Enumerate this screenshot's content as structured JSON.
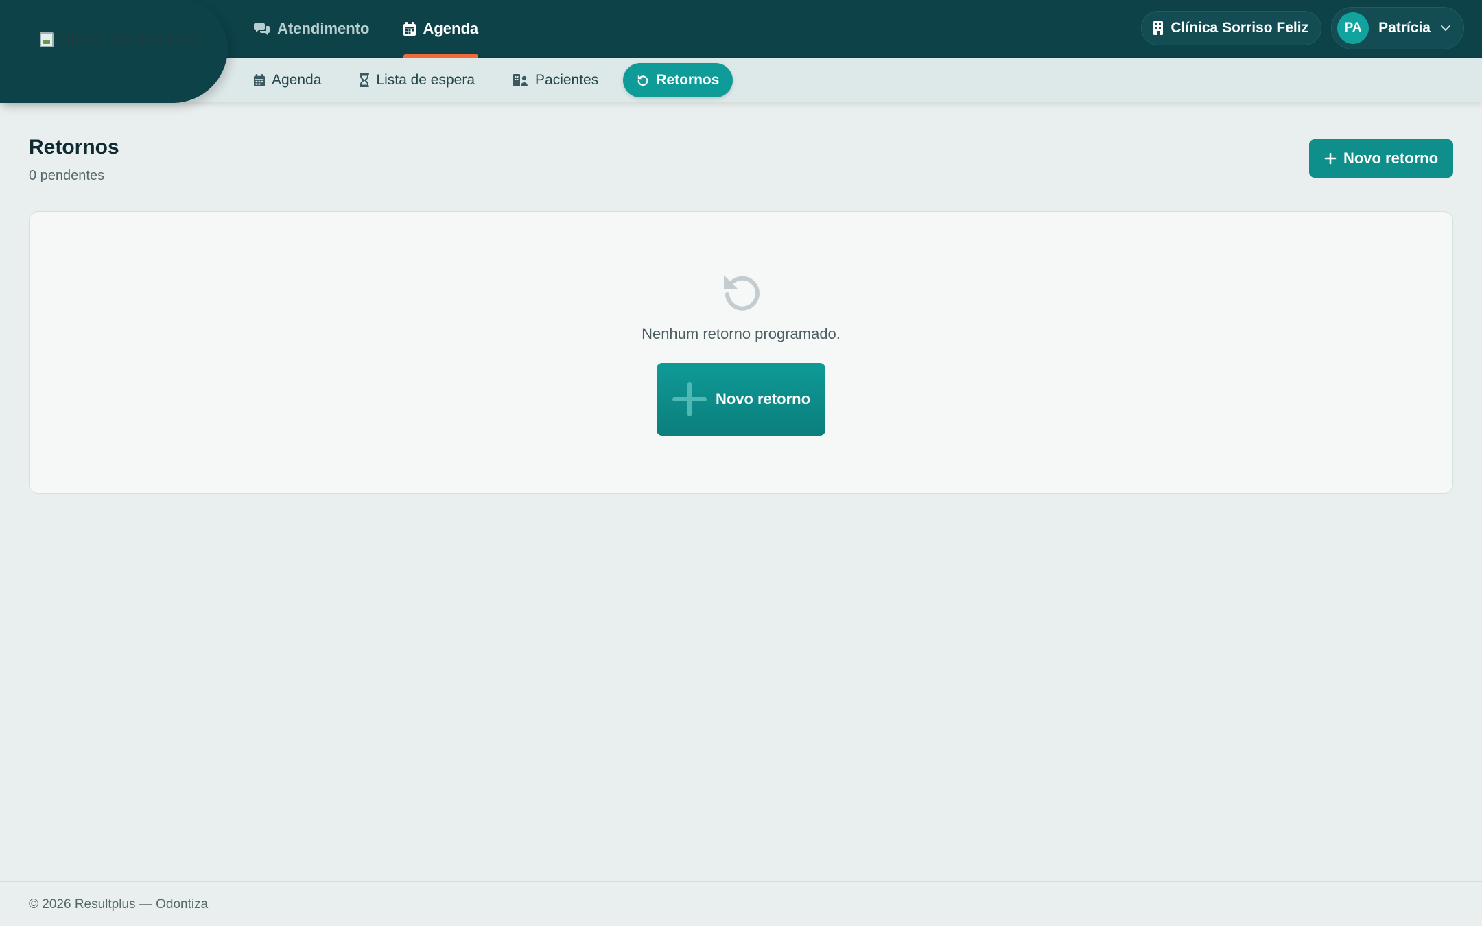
{
  "brand": {
    "logo_alt": "Clínica Sorriso Feliz"
  },
  "main_nav": {
    "items": [
      {
        "label": "Atendimento",
        "icon": "chat-icon",
        "active": false
      },
      {
        "label": "Agenda",
        "icon": "calendar-icon",
        "active": true
      }
    ]
  },
  "top_right": {
    "clinic_name": "Clínica Sorriso Feliz",
    "user_initials": "PA",
    "user_name": "Patrícia"
  },
  "sub_nav": {
    "items": [
      {
        "label": "Agenda",
        "icon": "calendar-icon",
        "active": false
      },
      {
        "label": "Lista de espera",
        "icon": "hourglass-icon",
        "active": false
      },
      {
        "label": "Pacientes",
        "icon": "patients-icon",
        "active": false
      },
      {
        "label": "Retornos",
        "icon": "return-icon",
        "active": true
      }
    ]
  },
  "page": {
    "title": "Retornos",
    "subtitle": "0 pendentes",
    "new_button_label": "Novo retorno"
  },
  "empty_state": {
    "message": "Nenhum retorno programado.",
    "button_label": "Novo retorno"
  },
  "footer": {
    "text": "© 2026 Resultplus — Odontiza"
  },
  "colors": {
    "topbar": "#0d4249",
    "accent": "#0f9b98",
    "active_underline": "#f06b3a",
    "background": "#e9efee"
  }
}
